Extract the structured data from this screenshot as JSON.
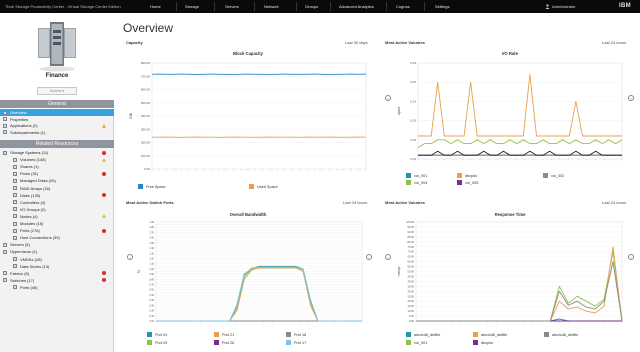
{
  "topbar": {
    "title": "Tivoli Storage Productivity Center - Virtual Storage Center Edition",
    "nav": [
      "Home",
      "Storage",
      "Servers",
      "Network",
      "Groups",
      "Advanced Analytics",
      "Cognos",
      "Settings"
    ],
    "user": "Administrator",
    "brand": "IBM"
  },
  "sidebar": {
    "entity_name": "Finance",
    "actions_label": "Actions",
    "general_header": "General",
    "general_items": [
      {
        "label": "Overview",
        "selected": true,
        "status": ""
      },
      {
        "label": "Properties",
        "status": ""
      },
      {
        "label": "Applications (2)",
        "status": "warning"
      },
      {
        "label": "Subdepartments (1)",
        "status": ""
      }
    ],
    "related_header": "Related Resources",
    "related_items": [
      {
        "label": "Storage Systems (11)",
        "level": 1,
        "status": "error"
      },
      {
        "label": "Volumes (148)",
        "level": 2,
        "status": "warning"
      },
      {
        "label": "Shares (1)",
        "level": 2,
        "status": ""
      },
      {
        "label": "Pools (31)",
        "level": 2,
        "status": "error"
      },
      {
        "label": "Managed Disks (26)",
        "level": 2,
        "status": ""
      },
      {
        "label": "RAID Arrays (16)",
        "level": 2,
        "status": ""
      },
      {
        "label": "Disks (139)",
        "level": 2,
        "status": "error"
      },
      {
        "label": "Controllers (4)",
        "level": 2,
        "status": ""
      },
      {
        "label": "I/O Groups (2)",
        "level": 2,
        "status": ""
      },
      {
        "label": "Nodes (4)",
        "level": 2,
        "status": "warning"
      },
      {
        "label": "Modules (15)",
        "level": 2,
        "status": ""
      },
      {
        "label": "Ports (176)",
        "level": 2,
        "status": "error"
      },
      {
        "label": "Host Connections (39)",
        "level": 2,
        "status": ""
      },
      {
        "label": "Servers (5)",
        "level": 1,
        "status": ""
      },
      {
        "label": "Hypervisors (1)",
        "level": 1,
        "status": ""
      },
      {
        "label": "VMDKs (28)",
        "level": 2,
        "status": ""
      },
      {
        "label": "Data Stores (13)",
        "level": 2,
        "status": ""
      },
      {
        "label": "Fabrics (5)",
        "level": 1,
        "status": "error"
      },
      {
        "label": "Switches (17)",
        "level": 1,
        "status": "error"
      },
      {
        "label": "Ports (46)",
        "level": 2,
        "status": ""
      }
    ]
  },
  "main": {
    "title": "Overview"
  },
  "panels": {
    "capacity": {
      "header": "Capacity",
      "range": "Last 30 days"
    },
    "volumes_io": {
      "header": "Most Active Volumes",
      "range": "Last 24 hours"
    },
    "switch_ports": {
      "header": "Most Active Switch Ports",
      "range": "Last 24 hours"
    },
    "volumes_rt": {
      "header": "Most Active Volumes",
      "range": "Last 24 hours"
    }
  },
  "colors": {
    "blue": "#2b86c4",
    "orange": "#e8a04b",
    "green": "#8fc24d",
    "gray": "#8a8a8a",
    "navy": "#1d2a6e",
    "purple": "#7b2d8e",
    "black": "#222222",
    "lightblue": "#7cc1ea",
    "teal": "#1b99a8"
  },
  "chart_data": [
    {
      "type": "line",
      "title": "Block Capacity",
      "xlabel": "",
      "ylabel": "GiB",
      "ylim": [
        0,
        800
      ],
      "yticks": [
        0,
        100,
        200,
        300,
        400,
        500,
        600,
        700,
        800
      ],
      "series": [
        {
          "name": "Free Space",
          "color": "#2b86c4",
          "values": [
            715,
            716,
            715,
            715,
            716,
            715,
            714,
            715,
            716,
            715,
            715,
            714,
            715,
            716,
            715,
            715,
            714,
            715,
            716,
            715,
            715,
            715,
            716,
            715,
            714,
            715,
            715,
            716,
            715,
            716
          ]
        },
        {
          "name": "Used Space",
          "color": "#e8a04b",
          "values": [
            240,
            240,
            241,
            240,
            239,
            240,
            241,
            240,
            240,
            239,
            240,
            241,
            240,
            240,
            239,
            240,
            241,
            240,
            240,
            240,
            239,
            241,
            240,
            240,
            241,
            240,
            239,
            240,
            241,
            240
          ]
        }
      ]
    },
    {
      "type": "line",
      "title": "I/O Rate",
      "xlabel": "",
      "ylabel": "ops/s",
      "ylim": [
        0,
        0.25
      ],
      "yticks": [
        0,
        0.05,
        0.1,
        0.15,
        0.2,
        0.25
      ],
      "series": [
        {
          "name": "vol_001",
          "color": "#1b99a8",
          "values": [
            0.01,
            0.01,
            0.01,
            0.01,
            0.01,
            0.01,
            0.01,
            0.01,
            0.01,
            0.01,
            0.01,
            0.01,
            0.01,
            0.01,
            0.01,
            0.01,
            0.01,
            0.01,
            0.01,
            0.01,
            0.01,
            0.01,
            0.01,
            0.01,
            0.01,
            0.01,
            0.01,
            0.01,
            0.01,
            0.01,
            0.01,
            0.01
          ]
        },
        {
          "name": "vol_004",
          "color": "#8fc24d",
          "values": [
            0.03,
            0.04,
            0.04,
            0.05,
            0.05,
            0.04,
            0.05,
            0.04,
            0.04,
            0.05,
            0.04,
            0.05,
            0.04,
            0.04,
            0.05,
            0.04,
            0.05,
            0.04,
            0.04,
            0.05,
            0.04,
            0.04,
            0.05,
            0.04,
            0.05,
            0.04,
            0.04,
            0.05,
            0.04,
            0.05,
            0.04,
            0.05
          ]
        },
        {
          "name": "dbcpdc",
          "color": "#e8a04b",
          "values": [
            0.06,
            0.06,
            0.06,
            0.2,
            0.06,
            0.06,
            0.06,
            0.06,
            0.2,
            0.06,
            0.06,
            0.06,
            0.06,
            0.06,
            0.06,
            0.06,
            0.06,
            0.22,
            0.06,
            0.06,
            0.06,
            0.06,
            0.06,
            0.06,
            0.15,
            0.06,
            0.06,
            0.06,
            0.06,
            0.06,
            0.06,
            0.06
          ]
        },
        {
          "name": "vol_005",
          "color": "#7b2d8e",
          "values": [
            0.01,
            0.01,
            0.01,
            0.01,
            0.01,
            0.01,
            0.01,
            0.01,
            0.01,
            0.01,
            0.01,
            0.01,
            0.01,
            0.01,
            0.01,
            0.01,
            0.01,
            0.01,
            0.01,
            0.01,
            0.01,
            0.01,
            0.01,
            0.01,
            0.01,
            0.01,
            0.01,
            0.01,
            0.01,
            0.01,
            0.01,
            0.01
          ]
        },
        {
          "name": "vol_002",
          "color": "#8a8a8a",
          "values": [
            0.01,
            0.01,
            0.01,
            0.01,
            0.01,
            0.01,
            0.01,
            0.01,
            0.01,
            0.01,
            0.01,
            0.01,
            0.01,
            0.01,
            0.01,
            0.01,
            0.01,
            0.01,
            0.01,
            0.01,
            0.01,
            0.01,
            0.01,
            0.01,
            0.01,
            0.01,
            0.01,
            0.01,
            0.01,
            0.01,
            0.01,
            0.01
          ]
        },
        {
          "name": "",
          "color": "#222222",
          "values": [
            0.01,
            0.01,
            0.01,
            0.02,
            0.01,
            0.01,
            0.02,
            0.01,
            0.01,
            0.01,
            0.02,
            0.01,
            0.01,
            0.02,
            0.01,
            0.01,
            0.01,
            0.02,
            0.01,
            0.01,
            0.02,
            0.01,
            0.01,
            0.01,
            0.02,
            0.01,
            0.01,
            0.02,
            0.01,
            0.01,
            0.01,
            0.01
          ]
        }
      ]
    },
    {
      "type": "line",
      "title": "Overall Bandwidth",
      "xlabel": "",
      "ylabel": "%",
      "ylim": [
        0,
        1.9
      ],
      "yticks": [
        0,
        0.05,
        0.1,
        0.15,
        0.2,
        0.25,
        0.3,
        0.35,
        0.4,
        0.45,
        0.5,
        0.55,
        0.6,
        0.65,
        0.7,
        0.75,
        0.8,
        0.85,
        0.9,
        0.95,
        1,
        1.05,
        1.1,
        1.15,
        1.2,
        1.25,
        1.3,
        1.35,
        1.4,
        1.45,
        1.5,
        1.55,
        1.6,
        1.65,
        1.7,
        1.75,
        1.8,
        1.85,
        1.9
      ],
      "series": [
        {
          "name": "Port 24",
          "color": "#1b99a8",
          "values": [
            0,
            0,
            0,
            0,
            0,
            0,
            0,
            0,
            0,
            0,
            0,
            0.3,
            0.9,
            1.0,
            1.05,
            1.05,
            1.05,
            1.05,
            1.05,
            1.05,
            1.0,
            0.4,
            0,
            0,
            0,
            0,
            0,
            0,
            0
          ]
        },
        {
          "name": "Port 23",
          "color": "#8fc24d",
          "values": [
            0,
            0,
            0,
            0,
            0,
            0,
            0,
            0,
            0,
            0,
            0,
            0.25,
            0.85,
            1.0,
            1.04,
            1.03,
            1.04,
            1.03,
            1.04,
            1.03,
            0.98,
            0.35,
            0,
            0,
            0,
            0,
            0,
            0,
            0
          ]
        },
        {
          "name": "Port 21",
          "color": "#e8a04b",
          "values": [
            0,
            0,
            0,
            0,
            0,
            0,
            0,
            0,
            0,
            0,
            0,
            0.2,
            0.8,
            0.98,
            1.02,
            1.02,
            1.02,
            1.02,
            1.02,
            1.02,
            0.95,
            0.3,
            0,
            0,
            0,
            0,
            0,
            0,
            0
          ]
        },
        {
          "name": "Port 26",
          "color": "#7b2d8e",
          "values": [
            0,
            0,
            0,
            0,
            0,
            0,
            0,
            0,
            0,
            0,
            0,
            0,
            0,
            0,
            0,
            0,
            0,
            0,
            0,
            0,
            0,
            0,
            0,
            0,
            0,
            0,
            0,
            0,
            0
          ]
        },
        {
          "name": "Port 18",
          "color": "#8a8a8a",
          "values": [
            0,
            0,
            0,
            0,
            0,
            0,
            0,
            0,
            0,
            0,
            0,
            0,
            0,
            0,
            0,
            0,
            0,
            0,
            0,
            0,
            0,
            0,
            0,
            0,
            0,
            0,
            0,
            0,
            0
          ]
        },
        {
          "name": "Port 17",
          "color": "#7cc1ea",
          "values": [
            0,
            0,
            0,
            0,
            0,
            0,
            0,
            0,
            0,
            0,
            0,
            0.28,
            0.88,
            1.02,
            1.03,
            1.04,
            1.03,
            1.04,
            1.03,
            1.04,
            1.0,
            0.38,
            0,
            0,
            0,
            0,
            0,
            0,
            0
          ]
        }
      ]
    },
    {
      "type": "line",
      "title": "Response Time",
      "xlabel": "",
      "ylabel": "ms/op",
      "ylim": [
        0,
        100
      ],
      "yticks": [
        0,
        5,
        10,
        15,
        20,
        25,
        30,
        35,
        40,
        45,
        50,
        55,
        60,
        65,
        70,
        75,
        80,
        85,
        90,
        95,
        100
      ],
      "series": [
        {
          "name": "atsvlcd6_de8tle",
          "color": "#1b99a8",
          "values": [
            0,
            0,
            0,
            0,
            0,
            0,
            0,
            0,
            0,
            0,
            0,
            0,
            0,
            0,
            0,
            0,
            2,
            0,
            0,
            0,
            0,
            0,
            0,
            0
          ]
        },
        {
          "name": "vol_001",
          "color": "#8fc24d",
          "values": [
            0,
            0,
            0,
            0,
            0,
            0,
            0,
            0,
            0,
            0,
            0,
            0,
            0,
            0,
            0,
            0,
            35,
            18,
            25,
            20,
            15,
            22,
            70,
            0
          ]
        },
        {
          "name": "atsvlcd6_de8tle",
          "color": "#e8a04b",
          "values": [
            0,
            0,
            0,
            0,
            0,
            0,
            0,
            0,
            0,
            0,
            0,
            0,
            0,
            0,
            0,
            0,
            20,
            12,
            14,
            10,
            8,
            15,
            75,
            0
          ]
        },
        {
          "name": "dbcpdc",
          "color": "#7b2d8e",
          "values": [
            0,
            0,
            0,
            0,
            0,
            0,
            0,
            0,
            0,
            0,
            0,
            0,
            0,
            0,
            0,
            0,
            0,
            0,
            0,
            0,
            0,
            0,
            0,
            0
          ]
        },
        {
          "name": "atsvlcd6_de8tle",
          "color": "#8a8a8a",
          "values": [
            0,
            0,
            0,
            0,
            0,
            0,
            0,
            0,
            0,
            0,
            0,
            0,
            0,
            0,
            0,
            0,
            30,
            16,
            20,
            14,
            12,
            20,
            60,
            0
          ]
        }
      ]
    }
  ]
}
